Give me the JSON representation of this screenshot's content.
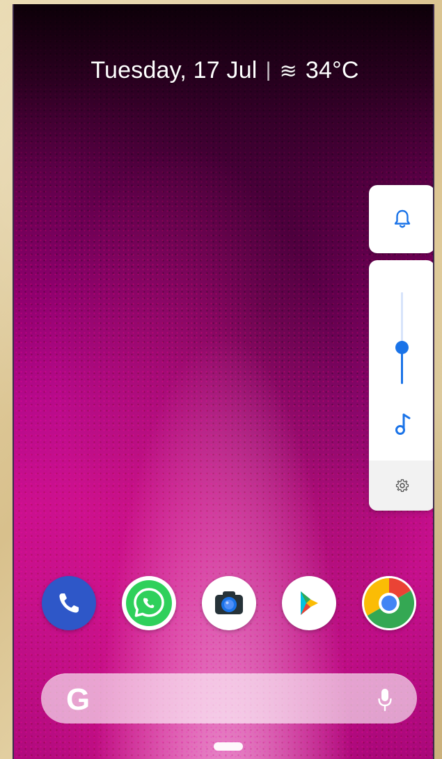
{
  "status": {
    "date": "Tuesday, 17 Jul",
    "separator": "|",
    "weather_icon": "≋",
    "temperature": "34°C"
  },
  "volume": {
    "level_fraction": 0.4
  },
  "dock": {
    "apps": [
      {
        "name": "Phone",
        "icon": "phone-icon"
      },
      {
        "name": "WhatsApp",
        "icon": "whatsapp-icon"
      },
      {
        "name": "Camera",
        "icon": "camera-icon"
      },
      {
        "name": "Play Store",
        "icon": "play-store-icon"
      },
      {
        "name": "Chrome",
        "icon": "chrome-icon"
      }
    ]
  },
  "search": {
    "logo": "G"
  },
  "colors": {
    "accent_blue": "#1a73e8",
    "wallpaper_pink": "#c90f8f",
    "panel_white": "#ffffff"
  }
}
